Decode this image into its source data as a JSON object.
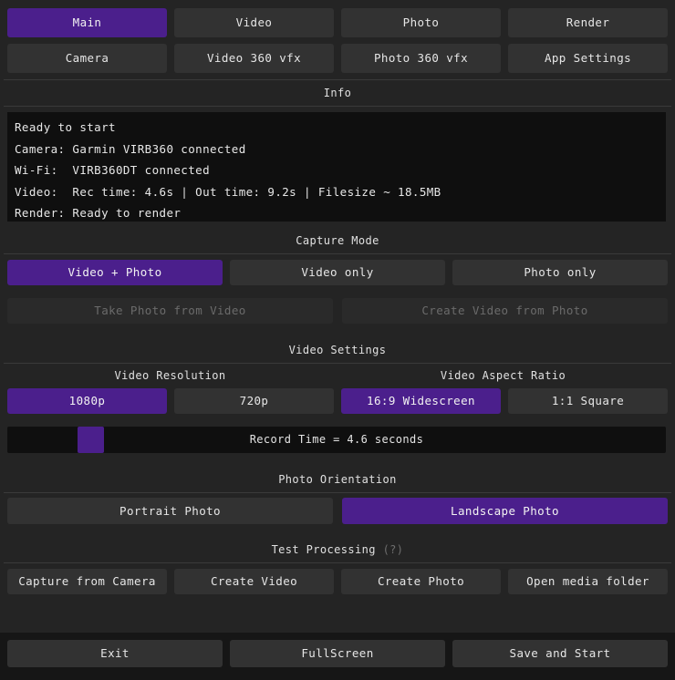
{
  "top_tabs": [
    "Main",
    "Video",
    "Photo",
    "Render"
  ],
  "second_tabs": [
    "Camera",
    "Video 360 vfx",
    "Photo 360 vfx",
    "App Settings"
  ],
  "info": {
    "title": "Info",
    "lines": [
      "Ready to start",
      "Camera: Garmin VIRB360 connected",
      "Wi-Fi:  VIRB360DT connected",
      "Video:  Rec time: 4.6s | Out time: 9.2s | Filesize ~ 18.5MB",
      "Render: Ready to render"
    ]
  },
  "capture_mode": {
    "title": "Capture Mode",
    "options": [
      "Video + Photo",
      "Video only",
      "Photo only"
    ],
    "selected": "Video + Photo",
    "extra_buttons": [
      "Take Photo from Video",
      "Create Video from Photo"
    ]
  },
  "video_settings": {
    "title": "Video Settings",
    "resolution_label": "Video Resolution",
    "resolution_options": [
      "1080p",
      "720p"
    ],
    "resolution_selected": "1080p",
    "aspect_label": "Video Aspect Ratio",
    "aspect_options": [
      "16:9 Widescreen",
      "1:1 Square"
    ],
    "aspect_selected": "16:9 Widescreen",
    "record_time_label": "Record Time = 4.6 seconds",
    "record_time_level": 0.115
  },
  "photo_orientation": {
    "title": "Photo Orientation",
    "options": [
      "Portrait Photo",
      "Landscape Photo"
    ],
    "selected": "Landscape Photo"
  },
  "test_processing": {
    "title": "Test Processing",
    "hint": "(?)",
    "buttons": [
      "Capture from Camera",
      "Create Video",
      "Create Photo",
      "Open media folder"
    ]
  },
  "footer": {
    "buttons": [
      "Exit",
      "FullScreen",
      "Save and Start"
    ]
  },
  "colors": {
    "accent": "#4b1f8c",
    "button": "#323232",
    "background": "#242424",
    "console": "#0f0f0f"
  }
}
